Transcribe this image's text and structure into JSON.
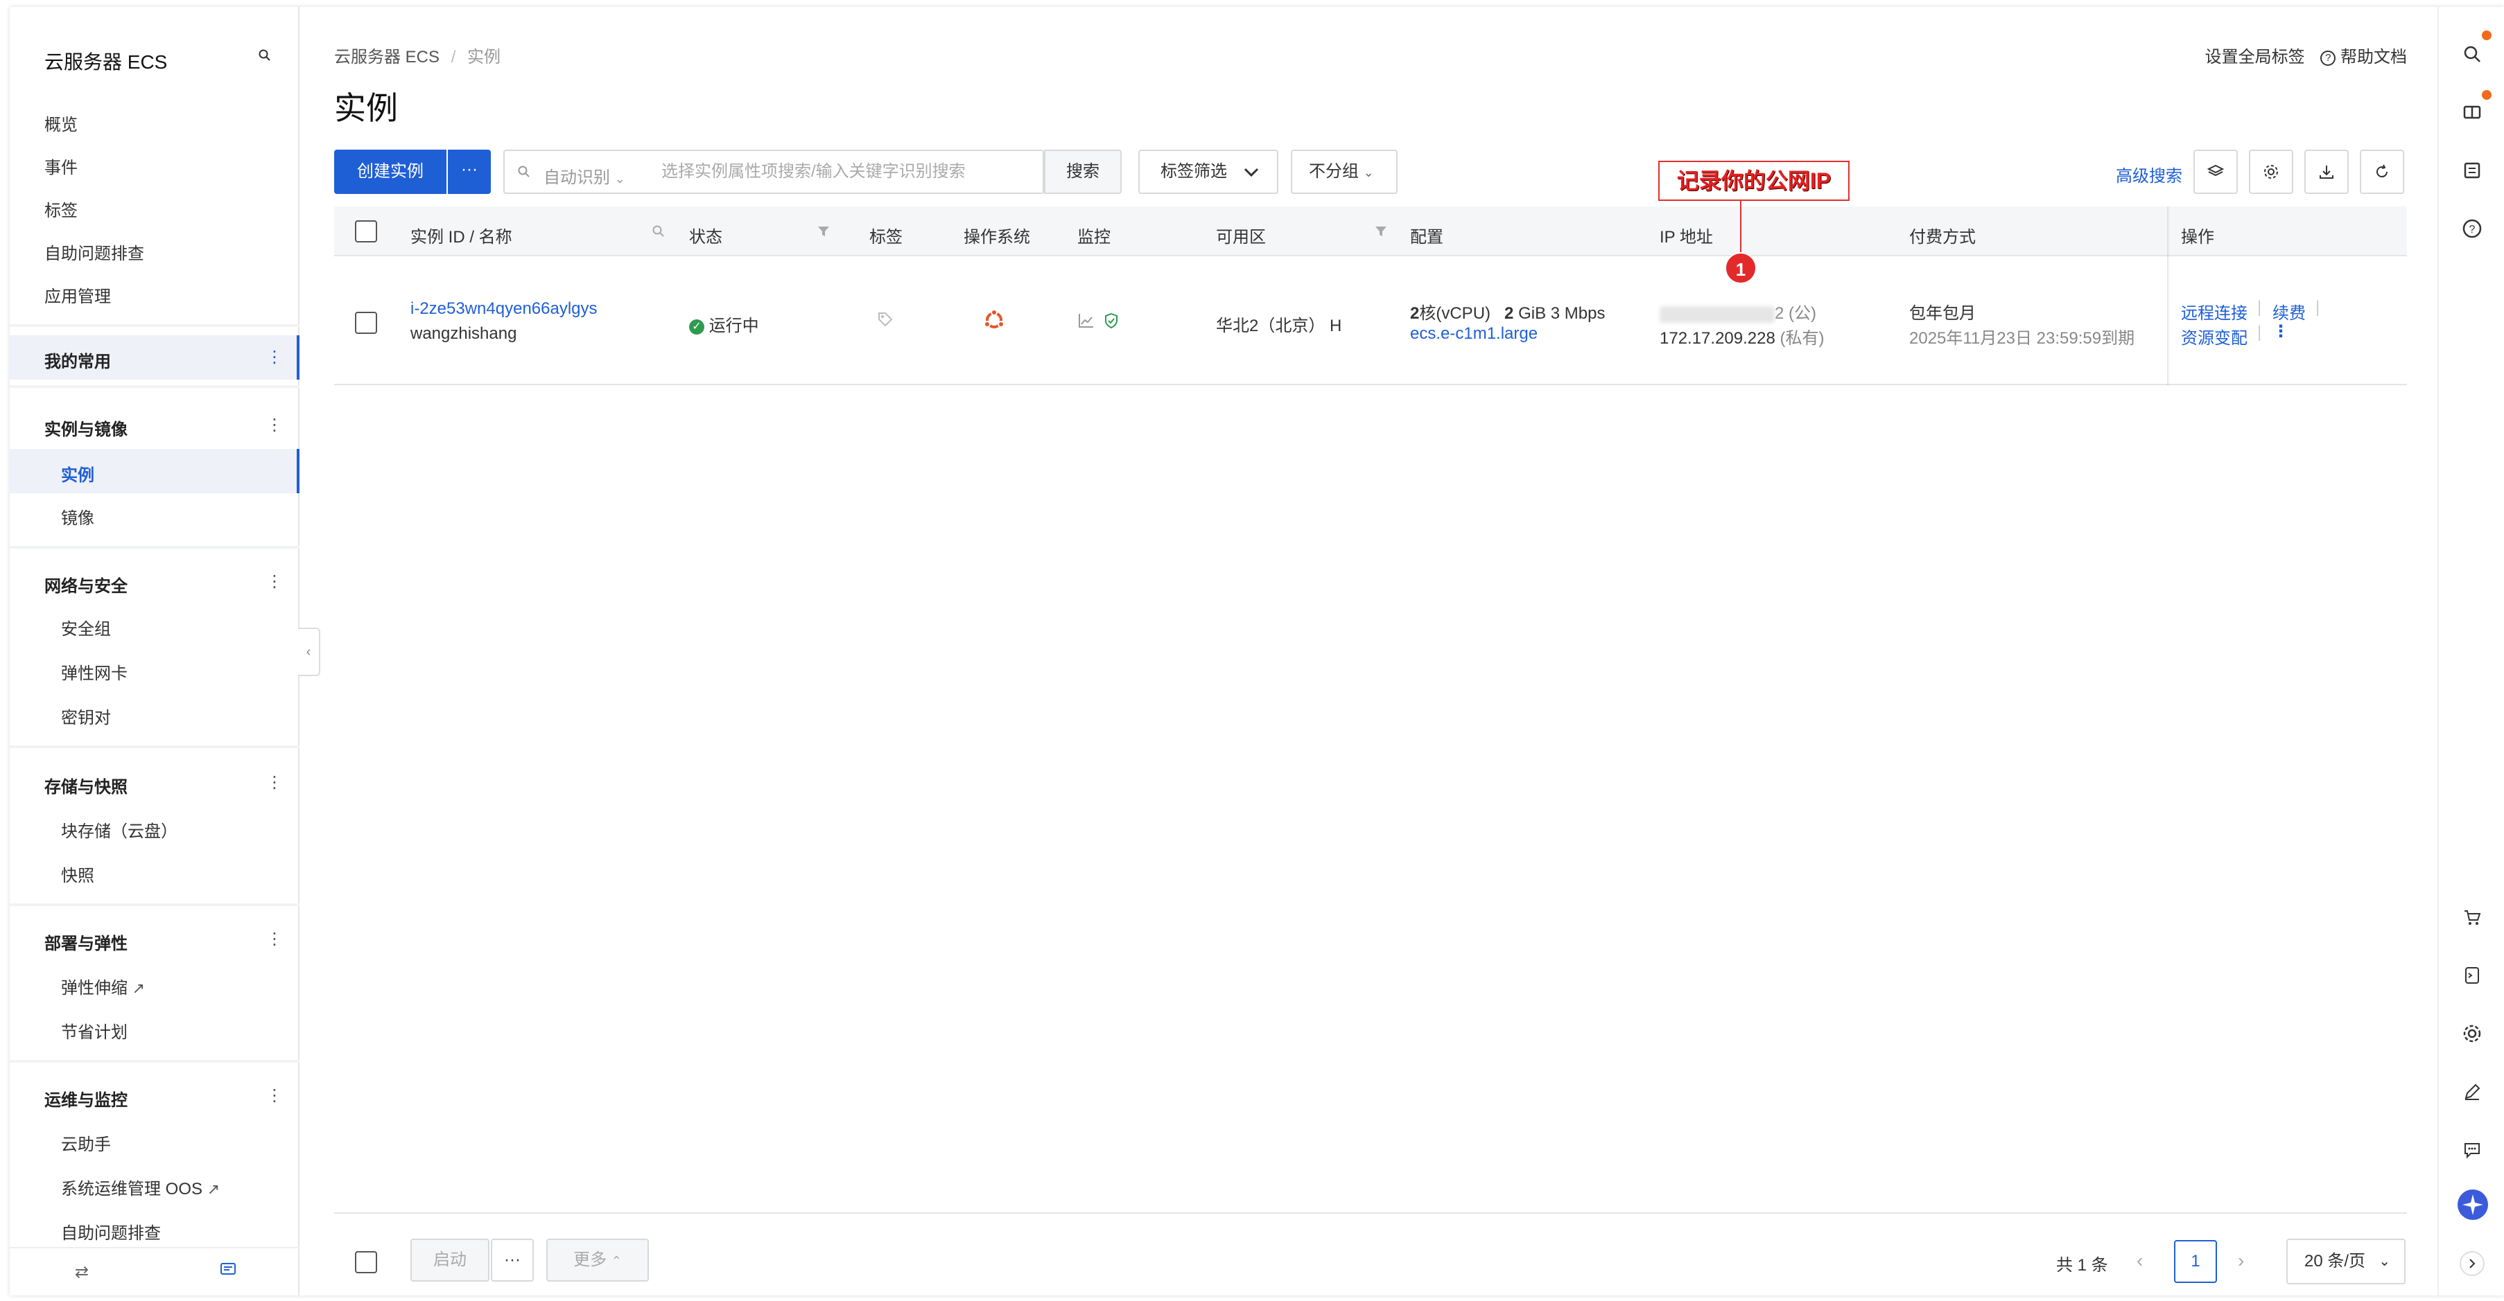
{
  "sidebar": {
    "title": "云服务器 ECS",
    "items": {
      "overview": "概览",
      "events": "事件",
      "tags": "标签",
      "self_diagnose": "自助问题排查",
      "app_manage": "应用管理",
      "favorites": "我的常用",
      "group_instances": "实例与镜像",
      "instances": "实例",
      "images": "镜像",
      "group_network": "网络与安全",
      "security_groups": "安全组",
      "eni": "弹性网卡",
      "key_pairs": "密钥对",
      "group_storage": "存储与快照",
      "block_storage": "块存储（云盘）",
      "snapshots": "快照",
      "group_deploy": "部署与弹性",
      "auto_scaling": "弹性伸缩",
      "savings_plan": "节省计划",
      "group_ops": "运维与监控",
      "cloud_assistant": "云助手",
      "oos": "系统运维管理 OOS",
      "self_diagnose_2": "自助问题排查"
    }
  },
  "header": {
    "breadcrumb_root": "云服务器 ECS",
    "breadcrumb_sep": "/",
    "breadcrumb_current": "实例",
    "title": "实例",
    "set_tags": "设置全局标签",
    "help_docs": "帮助文档"
  },
  "toolbar": {
    "create_label": "创建实例",
    "more_label": "···",
    "search_prefix": "自动识别",
    "search_placeholder": "选择实例属性项搜索/输入关键字识别搜索",
    "search_button": "搜索",
    "tag_filter": "标签筛选",
    "group_select": "不分组",
    "advanced_search": "高级搜索"
  },
  "annotation": {
    "callout_text": "记录你的公网IP",
    "step_number": "1"
  },
  "table": {
    "columns": {
      "id_name": "实例 ID / 名称",
      "status": "状态",
      "tags": "标签",
      "os": "操作系统",
      "monitor": "监控",
      "zone": "可用区",
      "config": "配置",
      "ip": "IP 地址",
      "billing": "付费方式",
      "actions": "操作"
    },
    "rows": [
      {
        "instance_id": "i-2ze53wn4qyen66aylgys",
        "name": "wangzhishang",
        "status": "运行中",
        "zone": "华北2（北京） H",
        "cpu": "2",
        "cpu_unit": "核(vCPU)",
        "mem": "2",
        "mem_unit": "GiB 3 Mbps",
        "instance_type": "ecs.e-c1m1.large",
        "public_ip_tail": "2 (公)",
        "private_ip": "172.17.209.228",
        "private_label": "(私有)",
        "billing": "包年包月",
        "expire": "2025年11月23日 23:59:59到期",
        "action_connect": "远程连接",
        "action_renew": "续费",
        "action_resize": "资源变配"
      }
    ]
  },
  "footer": {
    "start_button": "启动",
    "more_dots": "···",
    "more_button": "更多",
    "total": "共 1 条",
    "current_page": "1",
    "page_size": "20 条/页"
  },
  "colors": {
    "primary": "#1f5fd6",
    "running": "#2e9c4f",
    "annotation": "#e32a2a"
  }
}
